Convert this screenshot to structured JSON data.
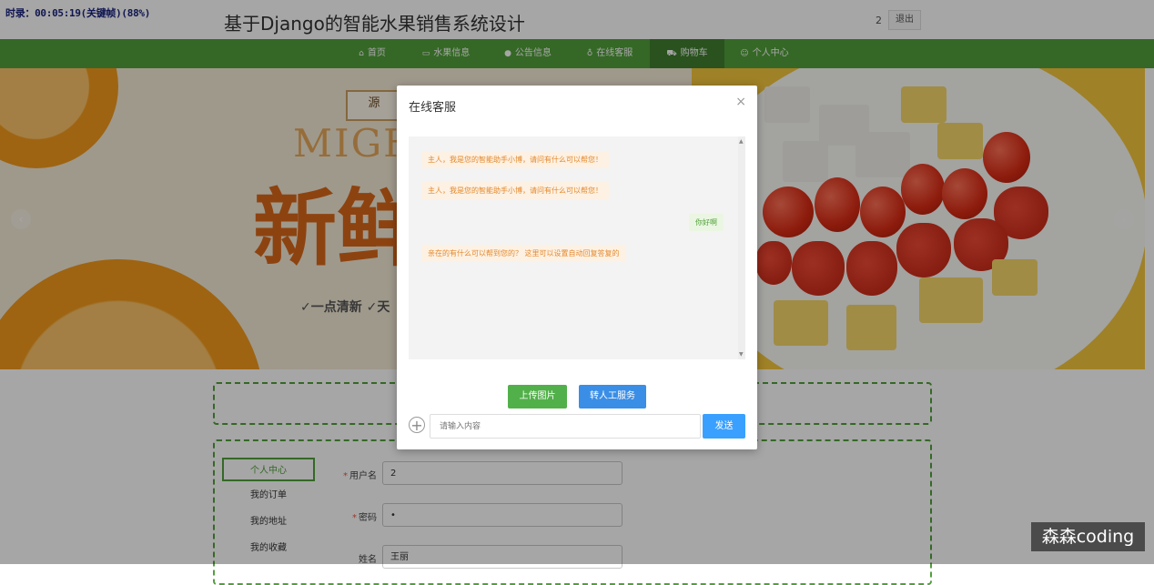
{
  "recording": "时录：00:05:19(关键帧)(88%)",
  "site": {
    "title": "基于Django的智能水果销售系统设计",
    "user_count": "2",
    "logout_label": "退出"
  },
  "nav": {
    "items": [
      {
        "label": "首页",
        "icon": "home-icon"
      },
      {
        "label": "水果信息",
        "icon": "bag-icon"
      },
      {
        "label": "公告信息",
        "icon": "info-icon"
      },
      {
        "label": "在线客服",
        "icon": "headset-icon"
      },
      {
        "label": "购物车",
        "icon": "cart-icon"
      },
      {
        "label": "个人中心",
        "icon": "user-icon"
      }
    ],
    "active_index": 4
  },
  "banner": {
    "brand": "源",
    "word": "MIGH",
    "big_text": "新鲜",
    "tagline": "✓一点清新 ✓天"
  },
  "sidebar": {
    "items": [
      "个人中心",
      "我的订单",
      "我的地址",
      "我的收藏"
    ],
    "active_index": 0
  },
  "form": {
    "username": {
      "label": "用户名",
      "value": "2"
    },
    "password": {
      "label": "密码",
      "value": "•"
    },
    "name": {
      "label": "姓名",
      "value": "王丽"
    }
  },
  "modal": {
    "title": "在线客服",
    "close": "×",
    "messages": [
      {
        "from": "bot",
        "text": "主人，我是您的智能助手小博，请问有什么可以帮您！"
      },
      {
        "from": "bot",
        "text": "主人，我是您的智能助手小博，请问有什么可以帮您！"
      },
      {
        "from": "user",
        "text": "你好啊"
      },
      {
        "from": "bot",
        "text": "亲在的有什么可以帮到您的？ 这里可以设置自动回复答复的"
      }
    ],
    "upload_label": "上传图片",
    "human_label": "转人工服务",
    "input_placeholder": "请输入内容",
    "send_label": "发送"
  },
  "watermark": "森森coding",
  "colors": {
    "primary": "#52a03b",
    "send": "#3aa0ff",
    "human": "#3a8ee6"
  }
}
